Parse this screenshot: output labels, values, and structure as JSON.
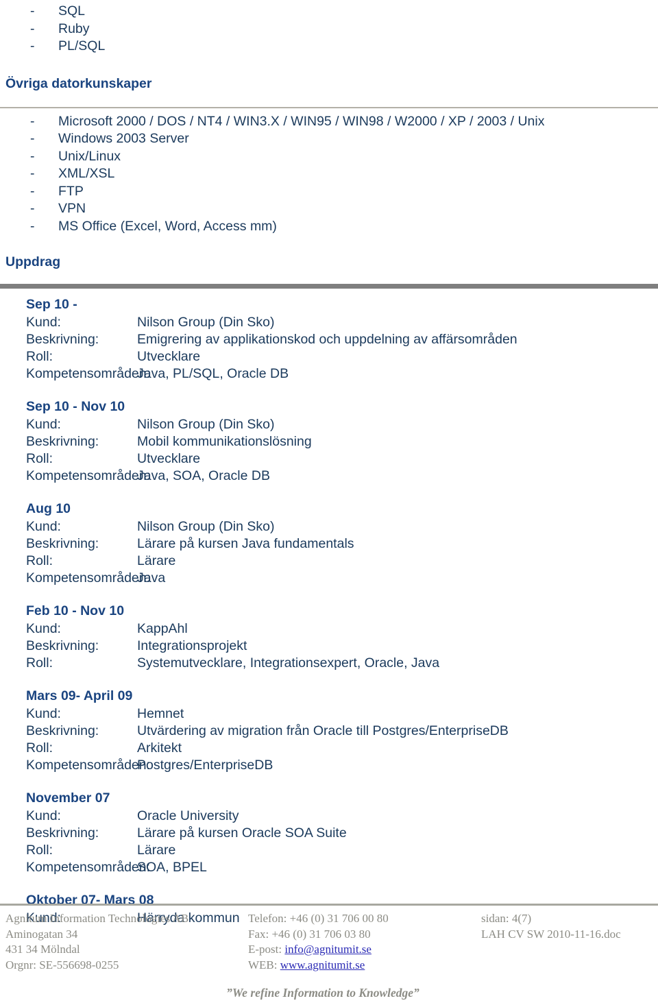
{
  "colors": {
    "body_text": "#1b3a5c",
    "heading": "#1a4480",
    "rule_thin": "#b3b0a8",
    "rule_thick": "#7f7f7f",
    "footer_text": "#8c8c85",
    "footer_link": "#2b2bb5"
  },
  "top_list": {
    "dash": "-",
    "items": [
      "SQL",
      "Ruby",
      "PL/SQL"
    ]
  },
  "other_skills": {
    "heading": "Övriga datorkunskaper",
    "dash": "-",
    "items": [
      "Microsoft 2000 / DOS / NT4 / WIN3.X / WIN95 / WIN98 / W2000 / XP / 2003 / Unix",
      "Windows 2003 Server",
      "Unix/Linux",
      "XML/XSL",
      "FTP",
      "VPN",
      "MS Office (Excel, Word, Access mm)"
    ]
  },
  "assignments_section": {
    "heading": "Uppdrag",
    "labels": {
      "kund": "Kund:",
      "beskrivning": "Beskrivning:",
      "roll": "Roll:",
      "kompetensomraden": "Kompetensområden:"
    },
    "items": [
      {
        "date": "Sep 10 -",
        "kund": "Nilson Group (Din Sko)",
        "beskrivning": "Emigrering av applikationskod och uppdelning av affärsområden",
        "roll": "Utvecklare",
        "kompetensomraden": "Java, PL/SQL, Oracle DB"
      },
      {
        "date": "Sep 10 - Nov 10",
        "kund": "Nilson Group (Din Sko)",
        "beskrivning": "Mobil kommunikationslösning",
        "roll": "Utvecklare",
        "kompetensomraden": "Java, SOA, Oracle DB"
      },
      {
        "date": "Aug 10",
        "kund": "Nilson Group (Din Sko)",
        "beskrivning": "Lärare på kursen Java fundamentals",
        "roll": "Lärare",
        "kompetensomraden": "Java"
      },
      {
        "date": "Feb 10 - Nov 10",
        "kund": "KappAhl",
        "beskrivning": "Integrationsprojekt",
        "roll": "Systemutvecklare, Integrationsexpert, Oracle, Java",
        "kompetensomraden": null
      },
      {
        "date": "Mars 09- April 09",
        "kund": "Hemnet",
        "beskrivning": "Utvärdering av migration från Oracle till Postgres/EnterpriseDB",
        "roll": "Arkitekt",
        "kompetensomraden": "Postgres/EnterpriseDB"
      },
      {
        "date": "November 07",
        "kund": "Oracle University",
        "beskrivning": "Lärare på kursen Oracle SOA Suite",
        "roll": "Lärare",
        "kompetensomraden": "SOA, BPEL"
      },
      {
        "date": "Oktober 07- Mars 08",
        "kund": "Härryda kommun",
        "beskrivning": null,
        "roll": null,
        "kompetensomraden": null
      }
    ]
  },
  "footer": {
    "company": "Agnitum Information Technologies AB",
    "street": "Aminogatan 34",
    "city": "431 34 Mölndal",
    "orgnr": "Orgnr: SE-556698-0255",
    "phone": "Telefon: +46 (0) 31 706 00 80",
    "fax": "Fax: +46 (0) 31 706 03 80",
    "email_label": "E-post: ",
    "email": "info@agnitumit.se",
    "web_label": "WEB: ",
    "web": "www.agnitumit.se",
    "page": "sidan: 4(7)",
    "docname": "LAH CV SW 2010-11-16.doc",
    "tagline": "”We refine Information to Knowledge”"
  }
}
